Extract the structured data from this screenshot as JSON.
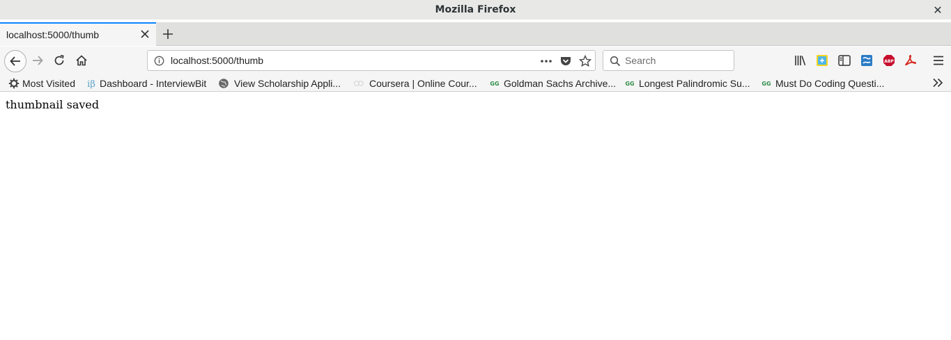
{
  "window": {
    "title": "Mozilla Firefox",
    "close_symbol": "✕"
  },
  "tabs": [
    {
      "label": "localhost:5000/thumb",
      "active": true
    }
  ],
  "navbar": {
    "url": "localhost:5000/thumb",
    "search_placeholder": "Search"
  },
  "bookmarks": [
    {
      "label": "Most Visited",
      "icon": "gear-icon"
    },
    {
      "label": "Dashboard - InterviewBit",
      "icon": "interviewbit-icon"
    },
    {
      "label": "View Scholarship Appli...",
      "icon": "globe-icon"
    },
    {
      "label": "Coursera | Online Cour...",
      "icon": "coursera-icon"
    },
    {
      "label": "Goldman Sachs Archive...",
      "icon": "gfg-icon"
    },
    {
      "label": "Longest Palindromic Su...",
      "icon": "gfg-icon"
    },
    {
      "label": "Must Do Coding Questi...",
      "icon": "gfg-icon"
    }
  ],
  "page": {
    "message": "thumbnail saved"
  },
  "colors": {
    "accent": "#0a84ff",
    "abp_red": "#c70d2c",
    "acrobat_red": "#d4291c",
    "gfg_green": "#2f8d46"
  }
}
